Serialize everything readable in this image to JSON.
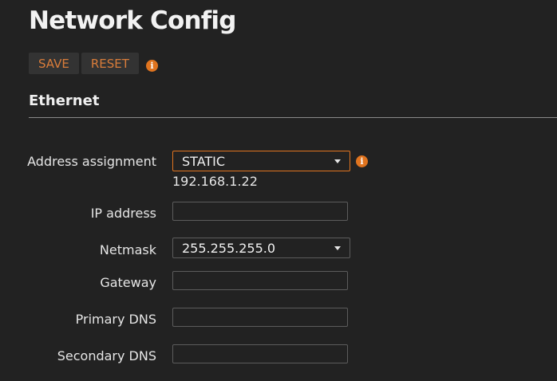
{
  "page": {
    "title": "Network Config"
  },
  "toolbar": {
    "save_label": "SAVE",
    "reset_label": "RESET",
    "info_icon": "info-icon"
  },
  "section": {
    "title": "Ethernet"
  },
  "form": {
    "address_assignment": {
      "label": "Address assignment",
      "value": "STATIC",
      "current_ip": "192.168.1.22"
    },
    "ip_address": {
      "label": "IP address",
      "value": ""
    },
    "netmask": {
      "label": "Netmask",
      "value": "255.255.255.0"
    },
    "gateway": {
      "label": "Gateway",
      "value": ""
    },
    "primary_dns": {
      "label": "Primary DNS",
      "value": ""
    },
    "secondary_dns": {
      "label": "Secondary DNS",
      "value": ""
    }
  },
  "colors": {
    "background": "#222222",
    "accent": "#e0741f",
    "button_text": "#d97c3a",
    "button_bg": "#333333",
    "text": "#e6e6e6"
  }
}
